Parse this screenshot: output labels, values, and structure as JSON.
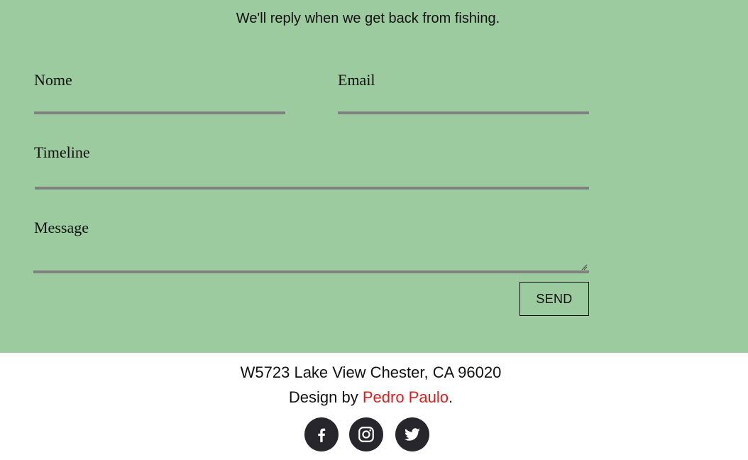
{
  "contact": {
    "subtitle": "We'll reply when we get back from fishing.",
    "fields": {
      "name_label": "Nome",
      "email_label": "Email",
      "timeline_label": "Timeline",
      "message_label": "Message"
    },
    "send_label": "SEND"
  },
  "footer": {
    "address": "W5723 Lake View Chester, CA 96020",
    "credit_prefix": "Design by ",
    "credit_name": "Pedro Paulo",
    "credit_suffix": ".",
    "social": [
      "facebook-icon",
      "instagram-icon",
      "twitter-icon"
    ]
  },
  "colors": {
    "section_bg": "#9bcb9e",
    "underline": "#808080",
    "link": "#e31b1b",
    "social_bg": "#27262c"
  }
}
